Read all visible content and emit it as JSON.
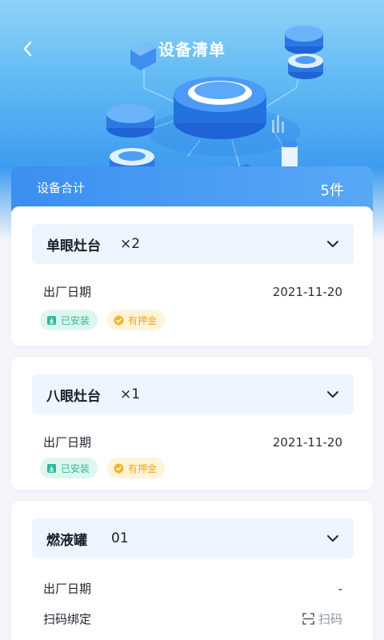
{
  "header": {
    "title": "设备清单",
    "back_icon": "chevron-left-icon"
  },
  "summary": {
    "label": "设备合计",
    "value": "5件"
  },
  "devices": [
    {
      "name": "单眼灶台",
      "qty": "×2",
      "date_label": "出厂日期",
      "date_value": "2021-11-20",
      "tags": {
        "installed": "已安装",
        "deposit": "有押金"
      }
    },
    {
      "name": "八眼灶台",
      "qty": "×1",
      "date_label": "出厂日期",
      "date_value": "2021-11-20",
      "tags": {
        "installed": "已安装",
        "deposit": "有押金"
      }
    },
    {
      "name": "燃液罐",
      "qty": "01",
      "date_label": "出厂日期",
      "date_value": "-",
      "bind_label": "扫码绑定",
      "scan_label": "扫码"
    }
  ],
  "colors": {
    "accent": "#3b8ff0",
    "installed": "#2fb898",
    "deposit": "#f0a81c"
  }
}
